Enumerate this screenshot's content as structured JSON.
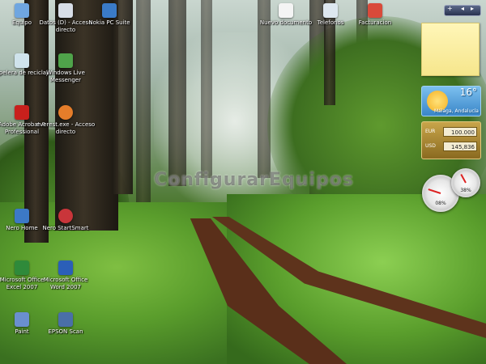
{
  "desktop": {
    "watermark": "ConfigurarEquipos",
    "icons": [
      {
        "label": "Equipo",
        "icon": "computer-icon",
        "color": "#6fa6e0"
      },
      {
        "label": "Datos (D) - Acceso directo",
        "icon": "drive-shortcut-icon",
        "color": "#d7dde6"
      },
      {
        "label": "Nokia PC Suite",
        "icon": "nokia-pc-suite-icon",
        "color": "#3a7bc8"
      },
      {
        "label": "Nuevo documento",
        "icon": "document-icon",
        "color": "#f4f4f4"
      },
      {
        "label": "Telefonos",
        "icon": "phone-book-icon",
        "color": "#dde7ef"
      },
      {
        "label": "Facturacion",
        "icon": "billing-app-icon",
        "color": "#d94a3a"
      },
      {
        "label": "Papelera de reciclaje",
        "icon": "recycle-bin-icon",
        "color": "#cfe3ec"
      },
      {
        "label": "Windows Live Messenger",
        "icon": "messenger-icon",
        "color": "#4fa34a"
      },
      {
        "label": "Adobe Acrobat 8 Professional",
        "icon": "acrobat-icon",
        "color": "#c8201c"
      },
      {
        "label": "everest.exe - Acceso directo",
        "icon": "everest-icon",
        "color": "#e57d2a"
      },
      {
        "label": "Nero Home",
        "icon": "nero-home-icon",
        "color": "#3c79c6"
      },
      {
        "label": "Nero StartSmart",
        "icon": "nero-startsmart-icon",
        "color": "#c9353a"
      },
      {
        "label": "Microsoft Office Excel 2007",
        "icon": "excel-icon",
        "color": "#2f8a3a"
      },
      {
        "label": "Microsoft Office Word 2007",
        "icon": "word-icon",
        "color": "#2b5fb8"
      },
      {
        "label": "Paint",
        "icon": "paint-icon",
        "color": "#6a8fcf"
      },
      {
        "label": "EPSON Scan",
        "icon": "epson-scan-icon",
        "color": "#4a6fa8"
      }
    ]
  },
  "sidebar": {
    "controls": {
      "add": "+",
      "prev": "◂",
      "next": "▸"
    },
    "note": {
      "text": ""
    },
    "weather": {
      "temperature": "16°",
      "city": "Málaga, Andalucía"
    },
    "currency": [
      {
        "code": "EUR",
        "value": "100.000"
      },
      {
        "code": "USD",
        "value": "145,836"
      }
    ],
    "cpu_meter": {
      "cpu_percent": 0.2,
      "memory_percent": 0.38,
      "readout_main": "08%",
      "readout_small": "38%"
    }
  }
}
